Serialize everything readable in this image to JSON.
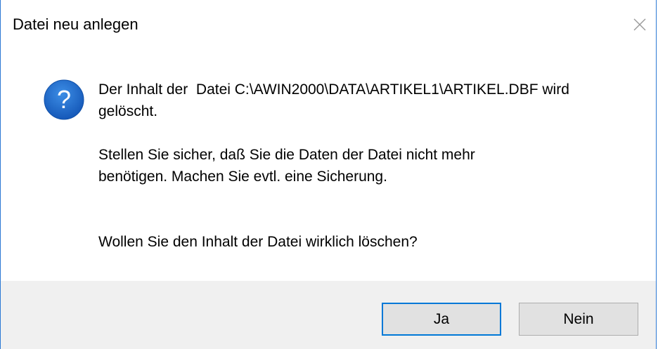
{
  "dialog": {
    "title": "Datei neu anlegen",
    "close_icon": "close-icon",
    "question_icon": "question-mark-icon",
    "message": {
      "line1": "Der Inhalt der  Datei C:\\AWIN2000\\DATA\\ARTIKEL1\\ARTIKEL.DBF wird\ngelöscht.",
      "line2": "Stellen Sie sicher, daß Sie die Daten der Datei nicht mehr\nbenötigen. Machen Sie evtl. eine Sicherung.",
      "line3": "Wollen Sie den Inhalt der Datei wirklich löschen?"
    },
    "buttons": {
      "yes_label": "Ja",
      "no_label": "Nein"
    }
  },
  "colors": {
    "accent": "#0078d7",
    "icon_blue": "#1e6fd0",
    "footer_bg": "#f0f0f0",
    "button_bg": "#e1e1e1"
  }
}
